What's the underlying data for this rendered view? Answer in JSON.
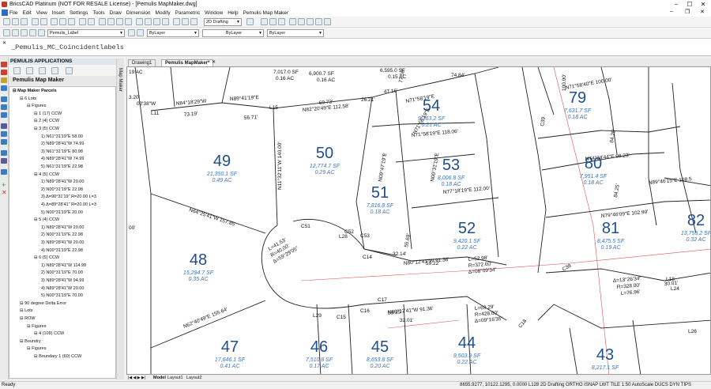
{
  "title_bar": {
    "title": "BricsCAD Platinum (NOT FOR RESALE License) - [Pemulis MapMaker.dwg]"
  },
  "menu": [
    "File",
    "Edit",
    "View",
    "Insert",
    "Settings",
    "Tools",
    "Draw",
    "Dimension",
    "Modify",
    "Parametric",
    "Window",
    "Help",
    "Pemulis Map Maker"
  ],
  "toolbar": {
    "layer": "Pemulis_Label",
    "color": "ByLayer",
    "linetype": "ByLayer",
    "lineweight": "ByLayer",
    "workspace": "2D Drafting"
  },
  "command_line": {
    "text": "_Pemulis_MC_Coincidentlabels"
  },
  "panel": {
    "header": "PEMULIS APPLICATIONS",
    "title": "Pemulis Map Maker",
    "vertical_tab": "Map Maker"
  },
  "tree": [
    {
      "d": 0,
      "t": "Map Maker Parcels"
    },
    {
      "d": 1,
      "t": "6 Lots"
    },
    {
      "d": 2,
      "t": "Figures"
    },
    {
      "d": 3,
      "t": "1 (17) CCW"
    },
    {
      "d": 3,
      "t": "2 (4) CCW"
    },
    {
      "d": 3,
      "t": "3 (5) CCW"
    },
    {
      "d": 4,
      "t": "1) N61°31'19\"E 58.00"
    },
    {
      "d": 4,
      "t": "2) N89°28'41\"W 74.99"
    },
    {
      "d": 4,
      "t": "3) N61°31'19\"E 80.98"
    },
    {
      "d": 4,
      "t": "4) N89°28'41\"W 74.99"
    },
    {
      "d": 4,
      "t": "5) N61°31'19\"E 22.98"
    },
    {
      "d": 3,
      "t": "4 (5) CCW"
    },
    {
      "d": 4,
      "t": "1) N89°28'41\"W 20.00"
    },
    {
      "d": 4,
      "t": "2) N00°31'19\"E 22.98"
    },
    {
      "d": 4,
      "t": "3) Δ=90°31'19\" R=20.00 L=3"
    },
    {
      "d": 4,
      "t": "4) Δ=89°28'41\" R=20.00 L=3"
    },
    {
      "d": 4,
      "t": "5) N00°31'19\"E 20.00"
    },
    {
      "d": 3,
      "t": "5 (4) CCW"
    },
    {
      "d": 4,
      "t": "1) N89°28'41\"W 20.00"
    },
    {
      "d": 4,
      "t": "2) N00°31'19\"E 22.98"
    },
    {
      "d": 4,
      "t": "3) N89°28'41\"W 20.00"
    },
    {
      "d": 4,
      "t": "4) N00°31'19\"E 22.98"
    },
    {
      "d": 3,
      "t": "6 (5) CCW"
    },
    {
      "d": 4,
      "t": "1) N89°28'41\"W 114.99"
    },
    {
      "d": 4,
      "t": "2) N00°31'19\"E 70.00"
    },
    {
      "d": 4,
      "t": "3) N89°28'41\"W 94.99"
    },
    {
      "d": 4,
      "t": "4) N89°28'41\"W 20.00"
    },
    {
      "d": 4,
      "t": "5) N00°31'19\"E 70.00"
    },
    {
      "d": 1,
      "t": "90 degree Delta Error"
    },
    {
      "d": 1,
      "t": "Lots"
    },
    {
      "d": 1,
      "t": "ROW"
    },
    {
      "d": 2,
      "t": "Figures"
    },
    {
      "d": 3,
      "t": "4 (109) CCW"
    },
    {
      "d": 1,
      "t": "Boundry"
    },
    {
      "d": 2,
      "t": "Figures"
    },
    {
      "d": 3,
      "t": "Boundary 1 (60) CCW"
    }
  ],
  "doc_tabs": [
    "Drawing1",
    "Pemulis MapMaker*"
  ],
  "layout_tabs": [
    "Model",
    "Layout1",
    "Layout2"
  ],
  "status": {
    "left": "Ready",
    "right": "8655.9277, 10122.1295, 0.0000   L128   2D Drafting   ORTHO  ISNAP  LWT  TILE  1:50  AutoScale  DUCS  DYN  TIPS"
  },
  "lots": [
    {
      "n": "49",
      "sf": "21,350.1 SF",
      "ac": "0.49 AC"
    },
    {
      "n": "50",
      "sf": "12,774.7 SF",
      "ac": "0.29 AC"
    },
    {
      "n": "51",
      "sf": "7,816.8 SF",
      "ac": "0.18 AC"
    },
    {
      "n": "52",
      "sf": "9,420.1 SF",
      "ac": "0.22 AC"
    },
    {
      "n": "53",
      "sf": "8,006.8 SF",
      "ac": "0.18 AC"
    },
    {
      "n": "54",
      "sf": "9,363.2 SF",
      "ac": "0.21 AC"
    },
    {
      "n": "48",
      "sf": "15,294.7 SF",
      "ac": "0.35 AC"
    },
    {
      "n": "47",
      "sf": "17,646.1 SF",
      "ac": "0.41 AC"
    },
    {
      "n": "46",
      "sf": "7,510.8 SF",
      "ac": "0.17 AC"
    },
    {
      "n": "45",
      "sf": "8,653.8 SF",
      "ac": "0.20 AC"
    },
    {
      "n": "44",
      "sf": "9,503.9 SF",
      "ac": "0.22 AC"
    },
    {
      "n": "79",
      "sf": "7,631.7 SF",
      "ac": "0.18 AC"
    },
    {
      "n": "80",
      "sf": "7,951.4 SF",
      "ac": "0.18 AC"
    },
    {
      "n": "81",
      "sf": "8,475.5 SF",
      "ac": "0.19 AC"
    },
    {
      "n": "82",
      "sf": "13,755.2 SF",
      "ac": "0.32 AC"
    },
    {
      "n": "43",
      "sf": "8,217.1 SF",
      "ac": ""
    }
  ],
  "bearings": [
    "N84°18'29\"W",
    "73.19'",
    "N89°41'19\"E",
    "56.71'",
    "N82°20'49\"E 112.58'",
    "69.73'",
    "L15",
    "L11",
    "N64°25'41\"W 157.85'",
    "N62°40'49\"E 155.64'",
    "N71°58'19\"E",
    "N71°58'19\"E 118.06'",
    "N77°18'19\"E 112.00'",
    "N80°12'41\"W 91.36'",
    "N80°12'41\"W 91.36'",
    "59.35'",
    "32.01'",
    "L28",
    "L29",
    "C51",
    "C52",
    "C53",
    "C14",
    "C15",
    "C16",
    "C17",
    "C18",
    "C38",
    "C39",
    "L24",
    "L26",
    "L18",
    "N74°34'44\"E 98.23'",
    "N71°58'40\"E 100.00'",
    "N79°46'09\"E 102.99'",
    "N89°46'15\"E 108.5",
    "L=52.98'",
    "R=372.00'",
    "Δ=08°09'34\"",
    "L=69.29'",
    "R=428.00'",
    "Δ=09°16'35\"",
    "Δ=13°26'34\"",
    "R=328.00'",
    "L=76.96'",
    "30.01'",
    "84.25'",
    "47.16'",
    "26.21'",
    "74.84'",
    "77.50'",
    "59.22'",
    "32.14'",
    "55.68'",
    "N09°47'19\"E",
    "N00°31'19\"E",
    "N11°32'11\"W 140.00'",
    "N71°58'19\"E",
    "6,900.7 SF",
    "0.16 AC",
    "7,017.0 SF",
    "0.16 AC",
    "6,595.0 SF",
    "0.15 AC",
    "19 AC",
    "3.20'",
    "02'38\"W",
    "00'",
    "84.25'",
    "100.00'",
    "L=41.53'",
    "R=40.00'",
    "Δ=59°29'05\""
  ],
  "colors": {
    "lot_number": "#1f4e8c",
    "lot_area": "#3a74c4",
    "lines": "#222",
    "row_red": "#d9534f"
  }
}
